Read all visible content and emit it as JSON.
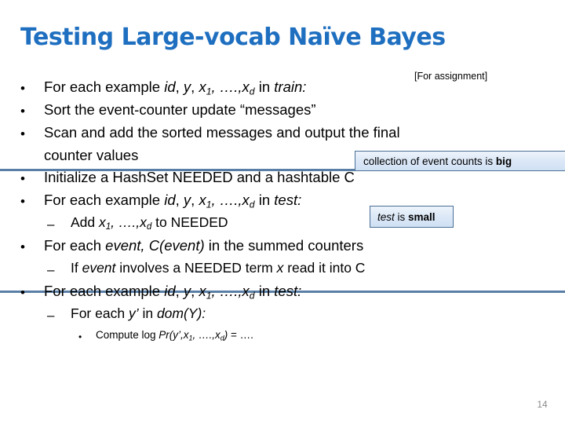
{
  "slide": {
    "title": "Testing Large-vocab Naïve Bayes",
    "page_number": "14",
    "assignment_note": "[For assignment]",
    "title_color": "#1f6fc0",
    "divider_color": "#5a7fa6",
    "page_number_color": "#8a8a8a"
  },
  "body": {
    "lines": [
      {
        "level": 1,
        "marker": "•",
        "html": "For each example <span class=\"it\">id</span>, <span class=\"it\">y</span>, <span class=\"it\">x<sub>1</sub>, ….,x<sub>d</sub></span> in <span class=\"it\">train:</span>",
        "text": "For each example id, y, x1, ….,xd in train:"
      },
      {
        "level": 1,
        "marker": "•",
        "html": "Sort the event-counter update “messages”",
        "text": "Sort the event-counter update “messages”"
      },
      {
        "level": 1,
        "marker": "•",
        "html": "Scan and add the sorted messages and output the final",
        "text": "Scan and add the sorted messages and output the final"
      },
      {
        "level": 0,
        "marker": "",
        "html": "counter values",
        "text": "counter values"
      },
      {
        "level": 1,
        "marker": "•",
        "html": "Initialize a HashSet NEEDED and a hashtable C",
        "text": "Initialize a HashSet NEEDED and a hashtable C"
      },
      {
        "level": 1,
        "marker": "•",
        "html": "For each example <span class=\"it\">id</span>, <span class=\"it\">y</span>, <span class=\"it\">x<sub>1</sub>, ….,x<sub>d</sub></span> in <span class=\"it\">test:</span>",
        "text": "For each example id, y, x1, ….,xd in test:"
      },
      {
        "level": 2,
        "marker": "–",
        "html": "Add <span class=\"it\">x<sub>1</sub>, ….,x<sub>d</sub></span> to NEEDED",
        "text": "Add x1, ….,xd to NEEDED"
      },
      {
        "level": 1,
        "marker": "•",
        "html": "For each <span class=\"it\">event, C(event)</span> in the summed counters",
        "text": "For each event, C(event) in the summed counters"
      },
      {
        "level": 2,
        "marker": "–",
        "html": "If <span class=\"it\">event</span> involves a NEEDED term <span class=\"it\">x</span> read it into C",
        "text": "If event involves a NEEDED term x read it into C"
      },
      {
        "level": 1,
        "marker": "•",
        "html": "For each example <span class=\"it\">id</span>, <span class=\"it\">y</span>, <span class=\"it\">x<sub>1</sub>, ….,x<sub>d</sub></span> in <span class=\"it\">test:</span>",
        "text": "For each example id, y, x1, ….,xd in test:"
      },
      {
        "level": 2,
        "marker": "–",
        "html": "For each <span class=\"it\">y’</span> in <span class=\"it\">dom(Y):</span>",
        "text": "For each y’ in dom(Y):"
      },
      {
        "level": 3,
        "marker": "•",
        "html": "Compute log <span class=\"it\">Pr(y’,x<sub>1</sub>, ….,x<sub>d</sub>)</span> = ….",
        "text": "Compute log Pr(y’,x1, ….,xd) = …."
      }
    ]
  },
  "callouts": [
    {
      "id": "callout-big",
      "html": "collection of event counts is <span class=\"b\">big</span>",
      "text": "collection of event counts is big"
    },
    {
      "id": "callout-small",
      "html": "<span class=\"i\">test</span> is <span class=\"b\">small</span>",
      "text": "test is small"
    }
  ]
}
